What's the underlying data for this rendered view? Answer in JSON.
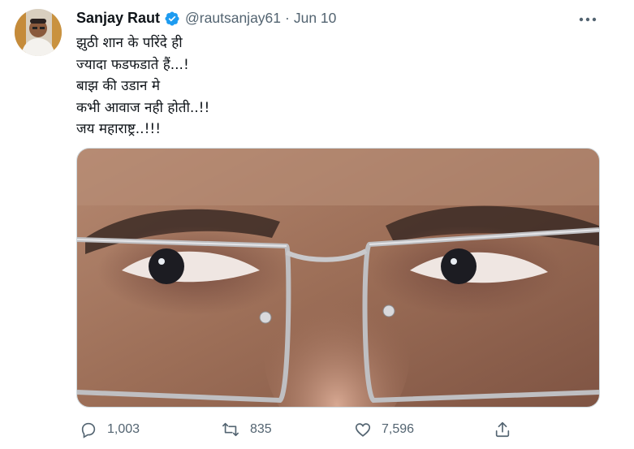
{
  "tweet": {
    "author_name": "Sanjay Raut",
    "handle": "@rautsanjay61",
    "separator": "·",
    "date": "Jun 10",
    "text_lines": [
      "झुठी शान के परिंदे ही",
      "ज्यादा फडफडाते हैं...!",
      "बाझ की उडान मे",
      "कभी आवाज नही होती..!!",
      "जय महाराष्ट्र..!!!"
    ]
  },
  "actions": {
    "replies": "1,003",
    "retweets": "835",
    "likes": "7,596"
  },
  "icons": {
    "verified": "verified-badge-icon",
    "more": "more-horizontal-icon",
    "reply": "reply-icon",
    "retweet": "retweet-icon",
    "like": "heart-icon",
    "share": "share-icon"
  },
  "colors": {
    "verified_blue": "#1d9bf0",
    "secondary_text": "#536471",
    "primary_text": "#0f1419"
  }
}
